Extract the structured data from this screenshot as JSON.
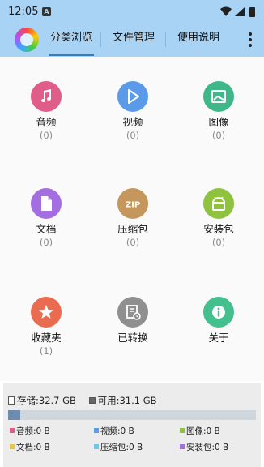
{
  "status_bar": {
    "time": "12:05",
    "notification_badge": "A"
  },
  "app_bar": {
    "tabs": [
      {
        "label": "分类浏览",
        "active": true
      },
      {
        "label": "文件管理",
        "active": false
      },
      {
        "label": "使用说明",
        "active": false
      }
    ]
  },
  "categories": [
    {
      "name": "音频",
      "count": "(0)",
      "color": "#e05d8a",
      "icon": "music-note-icon"
    },
    {
      "name": "视频",
      "count": "(0)",
      "color": "#5a9ae8",
      "icon": "play-icon"
    },
    {
      "name": "图像",
      "count": "(0)",
      "color": "#3fb889",
      "icon": "image-icon"
    },
    {
      "name": "文档",
      "count": "(0)",
      "color": "#a36fe0",
      "icon": "document-icon"
    },
    {
      "name": "压缩包",
      "count": "(0)",
      "color": "#c5975c",
      "icon": "zip-icon",
      "icon_text": "ZIP"
    },
    {
      "name": "安装包",
      "count": "(0)",
      "color": "#8fc23f",
      "icon": "android-icon"
    },
    {
      "name": "收藏夹",
      "count": "(1)",
      "color": "#ea6c50",
      "icon": "star-icon"
    },
    {
      "name": "已转换",
      "count": "",
      "color": "#8f8f8f",
      "icon": "converted-icon"
    },
    {
      "name": "关于",
      "count": "",
      "color": "#43c08e",
      "icon": "info-icon"
    }
  ],
  "storage": {
    "total_label": "存储:32.7 GB",
    "free_label": "可用:31.1 GB",
    "used_fraction": 0.049,
    "bar_fill_color": "#6e8dae",
    "legend": [
      {
        "label": "音频:0 B",
        "color": "#e05d8a"
      },
      {
        "label": "视频:0 B",
        "color": "#5a9ae8"
      },
      {
        "label": "图像:0 B",
        "color": "#8fc23f"
      },
      {
        "label": "文档:0 B",
        "color": "#e8c64a"
      },
      {
        "label": "压缩包:0 B",
        "color": "#6fc7e8"
      },
      {
        "label": "安装包:0 B",
        "color": "#a36fe0"
      }
    ]
  }
}
